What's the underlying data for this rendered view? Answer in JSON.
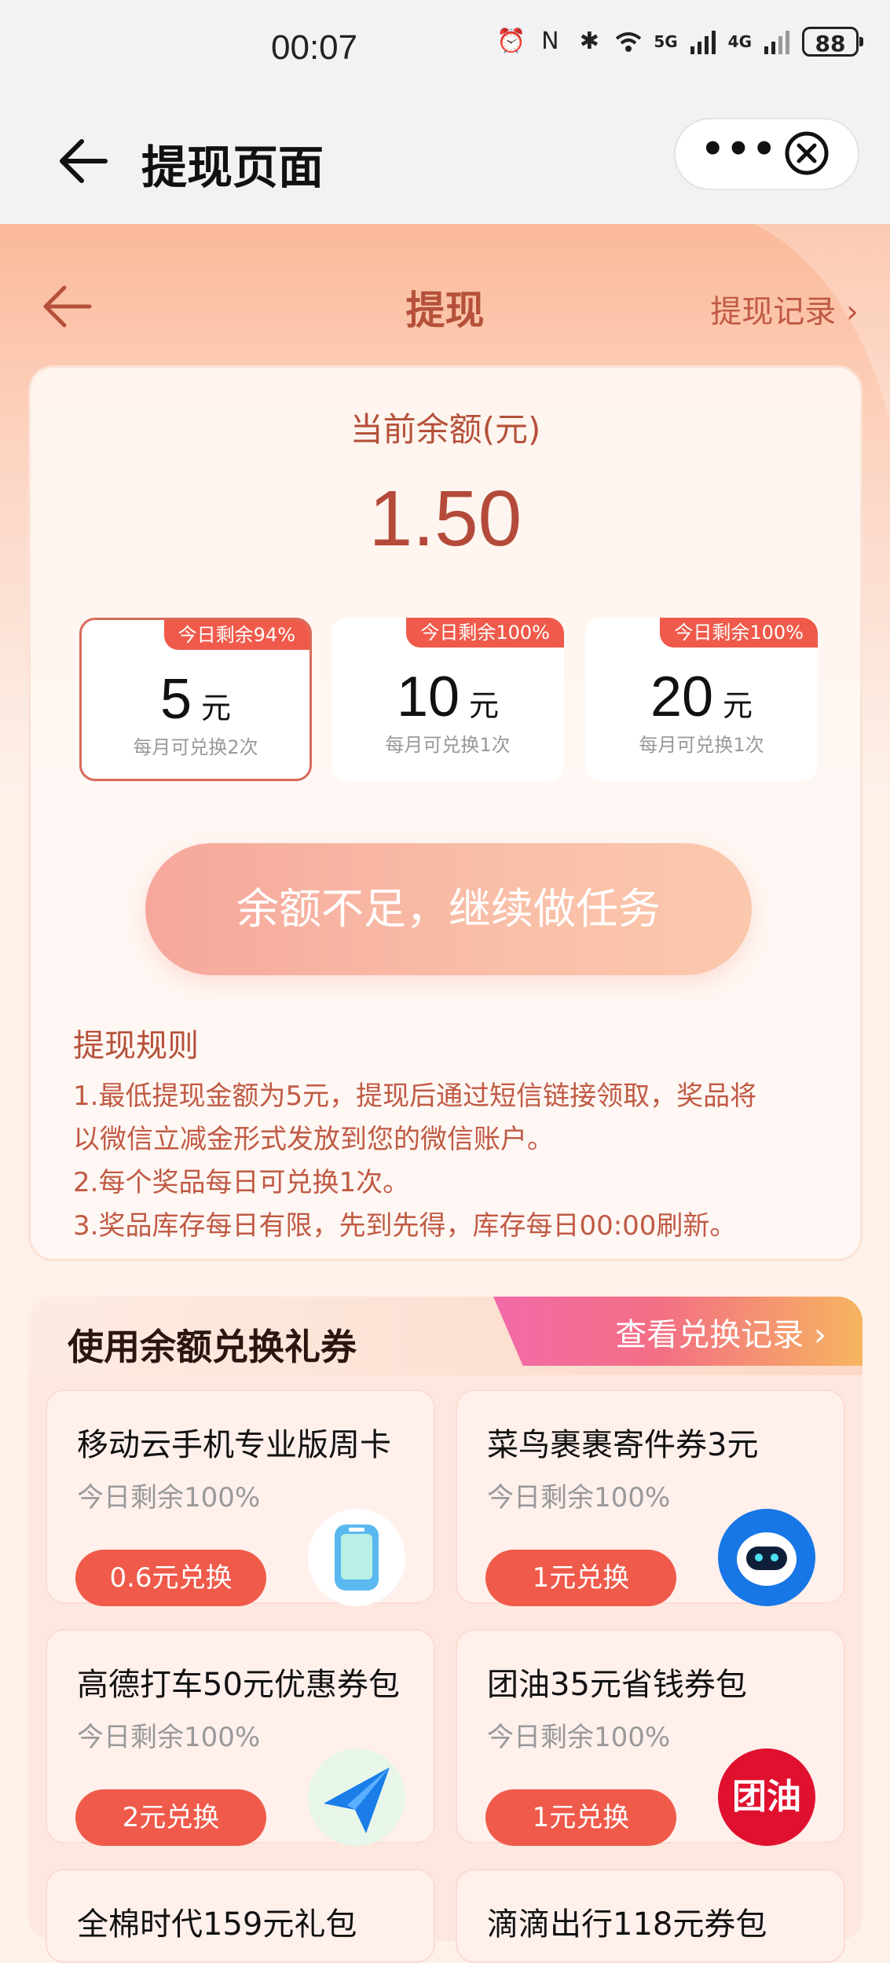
{
  "status_bar": {
    "time": "00:07",
    "battery": "88",
    "signal_5g": "5G",
    "signal_4g": "4G"
  },
  "nav": {
    "title": "提现页面"
  },
  "header": {
    "title": "提现",
    "record_link": "提现记录 ›"
  },
  "balance": {
    "label": "当前余额(元)",
    "value": "1.50"
  },
  "options": [
    {
      "tag": "今日剩余94%",
      "amount": "5",
      "unit": "元",
      "sub": "每月可兑换2次",
      "selected": true
    },
    {
      "tag": "今日剩余100%",
      "amount": "10",
      "unit": "元",
      "sub": "每月可兑换1次",
      "selected": false
    },
    {
      "tag": "今日剩余100%",
      "amount": "20",
      "unit": "元",
      "sub": "每月可兑换1次",
      "selected": false
    }
  ],
  "withdraw_button": "余额不足，继续做任务",
  "rules": {
    "title": "提现规则",
    "line1": "1.最低提现金额为5元，提现后通过短信链接领取，奖品将",
    "line2": "以微信立减金形式发放到您的微信账户。",
    "line3": "2.每个奖品每日可兑换1次。",
    "line4": "3.奖品库存每日有限，先到先得，库存每日00:00刷新。"
  },
  "exchange": {
    "title": "使用余额兑换礼券",
    "link": "查看兑换记录 ›",
    "items": [
      {
        "name": "移动云手机专业版周卡",
        "stock": "今日剩余100%",
        "button": "0.6元兑换",
        "icon": "cloud-phone-icon"
      },
      {
        "name": "菜鸟裹裹寄件券3元",
        "stock": "今日剩余100%",
        "button": "1元兑换",
        "icon": "cainiao-icon"
      },
      {
        "name": "高德打车50元优惠券包",
        "stock": "今日剩余100%",
        "button": "2元兑换",
        "icon": "amap-icon"
      },
      {
        "name": "团油35元省钱券包",
        "stock": "今日剩余100%",
        "button": "1元兑换",
        "icon": "tuanyou-icon",
        "logo_text": "团油"
      },
      {
        "name": "全棉时代159元礼包",
        "stock": "",
        "button": "",
        "icon": ""
      },
      {
        "name": "滴滴出行118元券包",
        "stock": "",
        "button": "",
        "icon": ""
      }
    ]
  },
  "colors": {
    "accent": "#f05a4a",
    "title_red": "#b5513a",
    "hero_top": "#fbb99a"
  }
}
